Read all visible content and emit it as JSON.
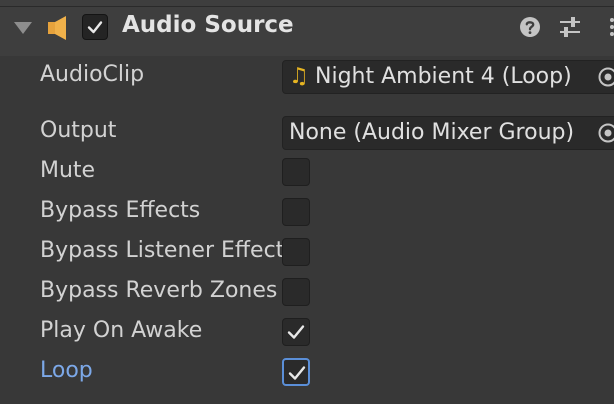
{
  "component": {
    "title": "Audio Source",
    "enabled": true
  },
  "fields": {
    "audio_clip": {
      "label": "AudioClip",
      "value": "Night Ambient 4 (Loop)",
      "icon": "music-note-icon"
    },
    "output": {
      "label": "Output",
      "value": "None (Audio Mixer Group)"
    },
    "mute": {
      "label": "Mute",
      "checked": false
    },
    "bypass_effects": {
      "label": "Bypass Effects",
      "checked": false
    },
    "bypass_listener_effects": {
      "label": "Bypass Listener Effects",
      "checked": false
    },
    "bypass_reverb_zones": {
      "label": "Bypass Reverb Zones",
      "checked": false
    },
    "play_on_awake": {
      "label": "Play On Awake",
      "checked": true
    },
    "loop": {
      "label": "Loop",
      "checked": true
    }
  },
  "colors": {
    "background": "#383838",
    "header": "#3e3e3e",
    "field": "#2a2a2a",
    "accent": "#7ca8e8",
    "speaker_icon": "#e6a23c",
    "note_icon": "#e6b422"
  }
}
